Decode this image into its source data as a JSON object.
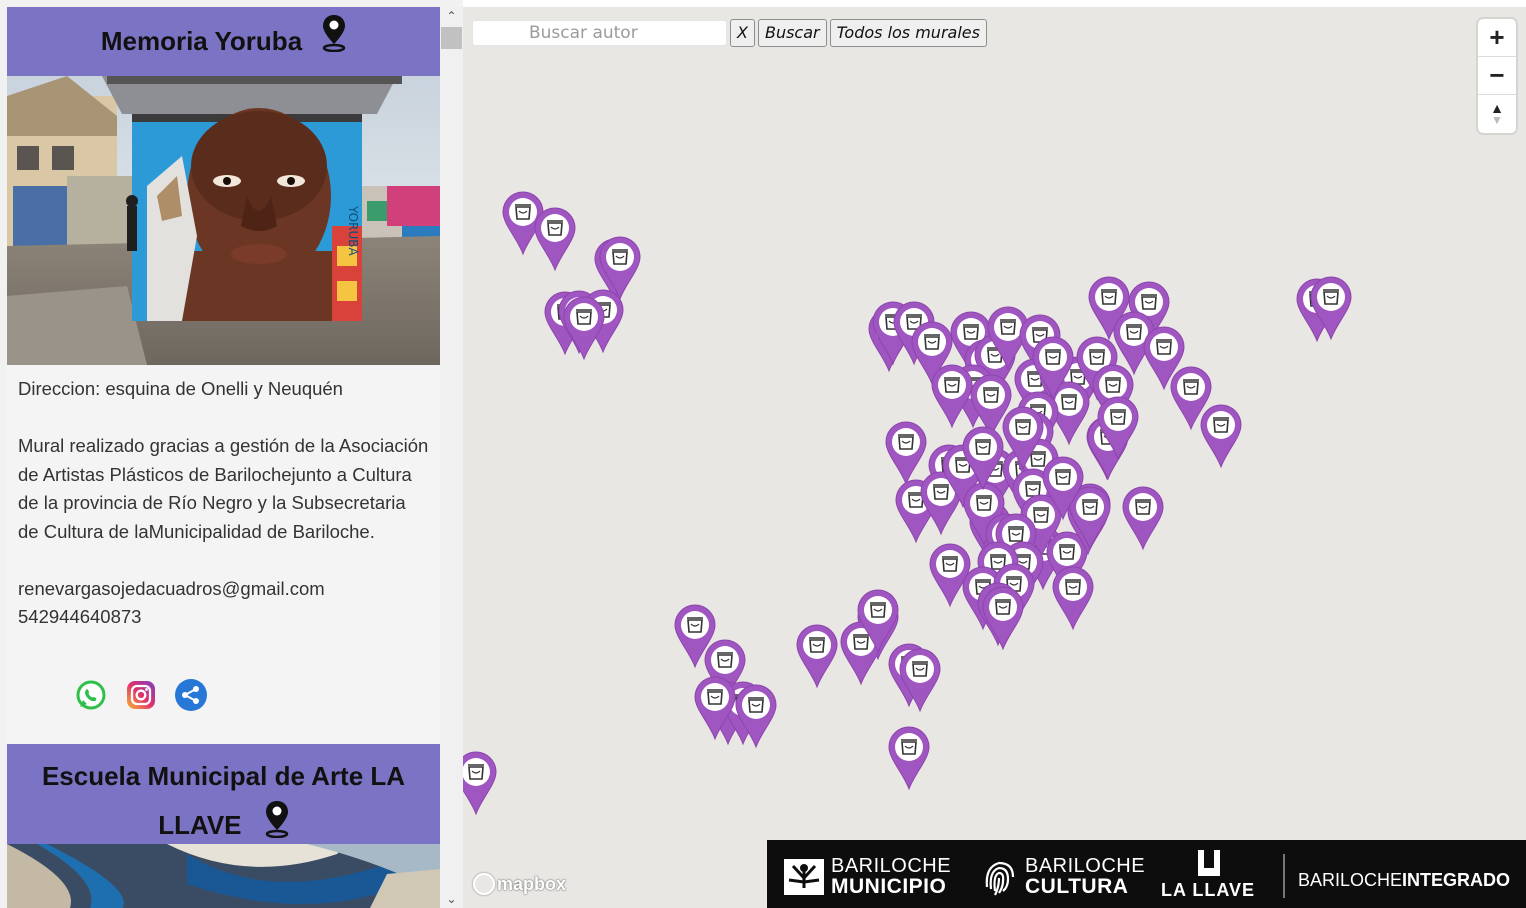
{
  "sidebar": {
    "card1": {
      "title": "Memoria Yoruba",
      "address": "Direccion: esquina de Onelli y Neuquén",
      "description": "Mural realizado gracias a gestión de la Asociación de Artistas Plásticos de Barilochejunto a Cultura de la provincia de Río Negro y la Subsecretaria de Cultura de laMunicipalidad de Bariloche.",
      "email": "renevargasojedacuadros@gmail.com",
      "phone": "542944640873",
      "mural_text": "YORUBA"
    },
    "card2": {
      "title": "Escuela Municipal de Arte LA LLAVE"
    },
    "colors": {
      "header": "#7b74c5",
      "marker": "#a056c1"
    }
  },
  "map": {
    "search": {
      "placeholder": "Buscar autor",
      "clear_label": "X",
      "search_label": "Buscar",
      "all_label": "Todos los murales"
    },
    "controls": {
      "zoom_in": "+",
      "zoom_out": "−",
      "compass": "▲"
    },
    "attribution": "mapbox"
  },
  "footer": {
    "municipio_line1": "BARILOCHE",
    "municipio_line2": "MUNICIPIO",
    "cultura_line1": "BARILOCHE",
    "cultura_line2": "CULTURA",
    "llave": "LA LLAVE",
    "integrado_a": "BARILOCHE",
    "integrado_b": "INTEGRADO"
  }
}
